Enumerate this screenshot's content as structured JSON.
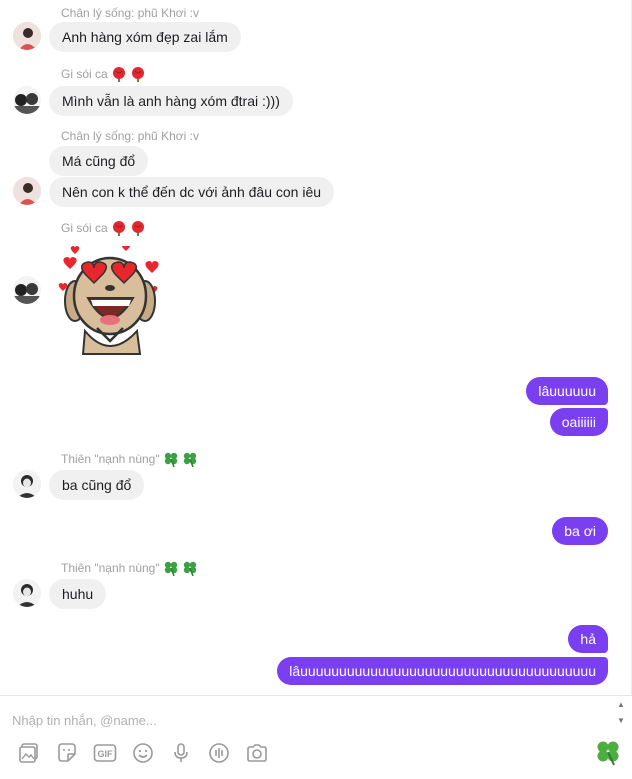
{
  "messages": {
    "m1": {
      "sender": "Chân lý sống: phũ Khơi :v",
      "text": "Anh hàng xóm đẹp zai lắm"
    },
    "m2": {
      "sender": "Gi sói ca",
      "text": "Mình vẫn là anh hàng xóm đtrai :)))"
    },
    "m3": {
      "sender": "Chân lý sống: phũ Khơi :v",
      "text1": "Má cũng đổ",
      "text2": "Nên con k thể đến dc với ảnh đâu con iêu"
    },
    "m4": {
      "sender": "Gi sói ca",
      "sticker": "heart-eyes-puppy-sticker"
    },
    "m5": {
      "text1": "lâuuuuuu",
      "text2": "oaiiiiii"
    },
    "m6": {
      "sender": "Thiên \"nạnh nùng\"",
      "text": "ba cũng đổ"
    },
    "m7": {
      "text": "ba ơi"
    },
    "m8": {
      "sender": "Thiên \"nạnh nùng\"",
      "text": "huhu"
    },
    "m9": {
      "text1": "hả",
      "text2": "lâuuuuuuuuuuuuuuuuuuuuuuuuuuuuuuuuuuuuuu"
    }
  },
  "composer": {
    "placeholder": "Nhập tin nhắn, @name...",
    "tools": [
      "photo-icon",
      "sticker-icon",
      "gif-icon",
      "emoji-icon",
      "microphone-icon",
      "audio-wave-icon",
      "camera-icon"
    ],
    "gif_label": "GIF",
    "send_emoji": "clover-icon"
  },
  "colors": {
    "accent": "#7b3ff2",
    "incoming_bubble": "#f1f0f0",
    "sender_text": "#a0a0a0"
  }
}
